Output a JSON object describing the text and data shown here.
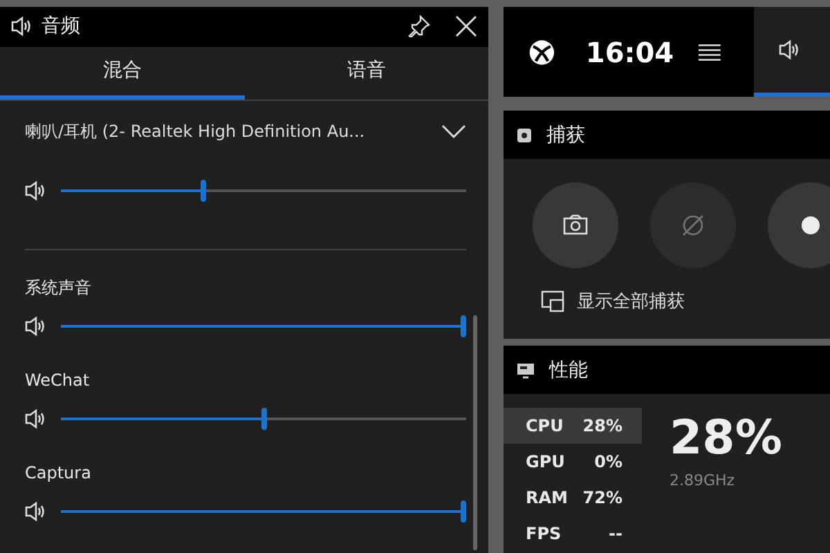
{
  "audio_panel": {
    "title": "音频",
    "tabs": [
      {
        "label": "混合",
        "selected": true
      },
      {
        "label": "语音",
        "selected": false
      }
    ],
    "device": {
      "name": "喇叭/耳机 (2- Realtek High Definition Au...",
      "level": 0.35
    },
    "apps": [
      {
        "name": "系统声音",
        "level": 1.0
      },
      {
        "name": "WeChat",
        "level": 0.5
      },
      {
        "name": "Captura",
        "level": 1.0
      }
    ]
  },
  "top_bar": {
    "time": "16:04",
    "audio_widget": {
      "selected": true
    }
  },
  "capture": {
    "title": "捕获",
    "buttons": [
      {
        "kind": "screenshot",
        "disabled": false
      },
      {
        "kind": "record_last",
        "disabled": true
      },
      {
        "kind": "record",
        "disabled": false
      }
    ],
    "show_all": "显示全部捕获"
  },
  "performance": {
    "title": "性能",
    "metrics": [
      {
        "label": "CPU",
        "value": "28%",
        "selected": true
      },
      {
        "label": "GPU",
        "value": "0%",
        "selected": false
      },
      {
        "label": "RAM",
        "value": "72%",
        "selected": false
      },
      {
        "label": "FPS",
        "value": "--",
        "selected": false
      }
    ],
    "big_value": "28%",
    "frequency": "2.89GHz"
  }
}
